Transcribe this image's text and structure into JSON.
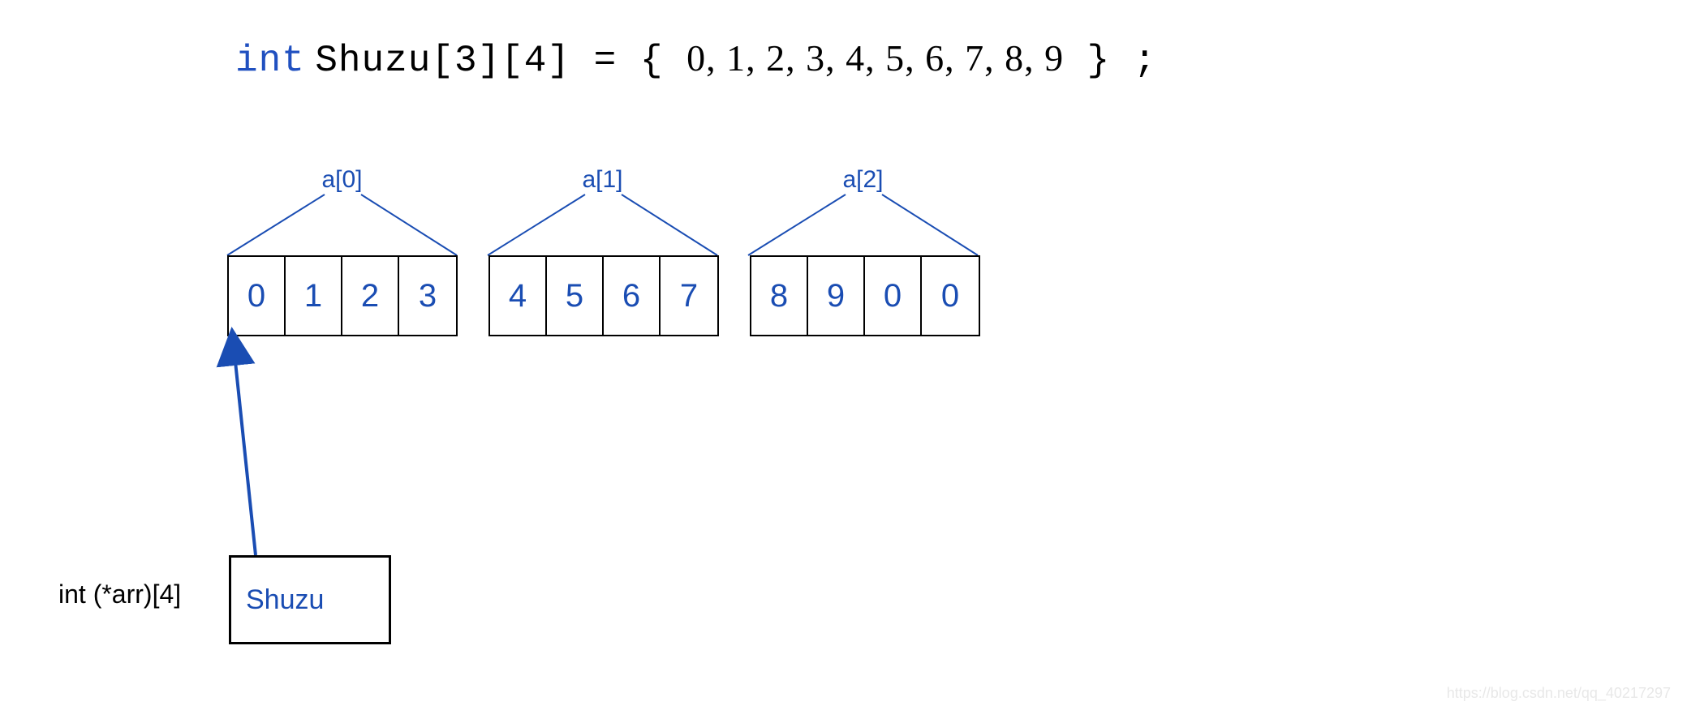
{
  "declaration": {
    "keyword": "int",
    "name": "Shuzu",
    "dim1": "[3]",
    "dim2": "[4]",
    "equals": " = ",
    "open": "{ ",
    "values": "0, 1, 2, 3, 4, 5, 6, 7, 8, 9",
    "close": " } ;"
  },
  "groups": [
    {
      "label": "a[0]",
      "cells": [
        "0",
        "1",
        "2",
        "3"
      ]
    },
    {
      "label": "a[1]",
      "cells": [
        "4",
        "5",
        "6",
        "7"
      ]
    },
    {
      "label": "a[2]",
      "cells": [
        "8",
        "9",
        "0",
        "0"
      ]
    }
  ],
  "pointer": {
    "type_text": "int (*arr)[4]",
    "box_text": "Shuzu"
  },
  "watermark": "https://blog.csdn.net/qq_40217297",
  "colors": {
    "accent": "#1a4db3",
    "keyword": "#2050c0"
  }
}
